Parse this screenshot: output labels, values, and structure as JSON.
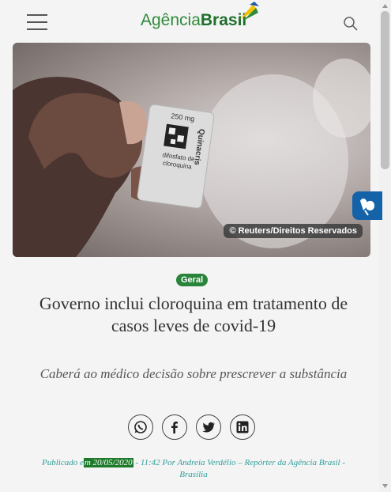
{
  "header": {
    "logo_part1": "Agência",
    "logo_part2": "Brasil",
    "menu_icon": "hamburger-menu-icon",
    "search_icon": "search-icon"
  },
  "hero": {
    "credit": "© Reuters/Direitos Reservados",
    "pack_labels": [
      "250 mg",
      "Quinacris",
      "difosfato de",
      "cloroquina"
    ]
  },
  "accessibility": {
    "icon": "libras-hands-icon",
    "color": "#1463a8"
  },
  "article": {
    "category": "Geral",
    "title": "Governo inclui cloroquina em tratamento de casos leves de covid-19",
    "subtitle": "Caberá ao médico decisão sobre prescrever a substância",
    "share": [
      {
        "name": "whatsapp-icon"
      },
      {
        "name": "facebook-icon"
      },
      {
        "name": "twitter-icon"
      },
      {
        "name": "linkedin-icon"
      }
    ],
    "byline_prefix": "Publicado e",
    "byline_highlight": "m 20/05/2020",
    "byline_rest": " - 11:42 Por Andreia Verdélio – Repórter da Agência Brasil - Brasília"
  },
  "colors": {
    "brand_green": "#28843a",
    "byline_teal": "#2e9f9a"
  }
}
